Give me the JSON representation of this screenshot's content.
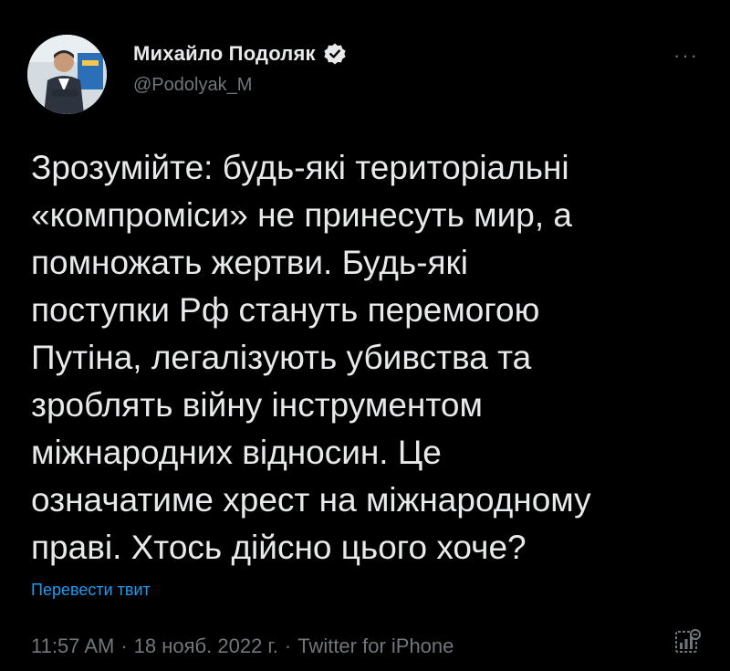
{
  "author": {
    "display_name": "Михайло Подоляк",
    "handle": "@Podolyak_M"
  },
  "tweet": {
    "text": "Зрозумійте: будь-які територіальні\n«компроміси» не принесуть мир, а\nпомножать жертви. Будь-які\nпоступки Рф стануть перемогою\nПутіна, легалізують убивства та\nзроблять війну інструментом\nміжнародних відносин. Це\nозначатиме хрест на міжнародному\nправі. Хтось дійсно цього хоче?",
    "translate_label": "Перевести твит",
    "time": "11:57 AM",
    "date": "18 нояб. 2022 г.",
    "source": "Twitter for iPhone",
    "separator": "·"
  },
  "icons": {
    "more": "more-icon",
    "verified": "verified-badge-icon",
    "analytics": "analytics-icon"
  },
  "colors": {
    "background": "#000000",
    "text": "#e7e9ea",
    "secondary": "#71767b",
    "link": "#1d9bf0"
  }
}
